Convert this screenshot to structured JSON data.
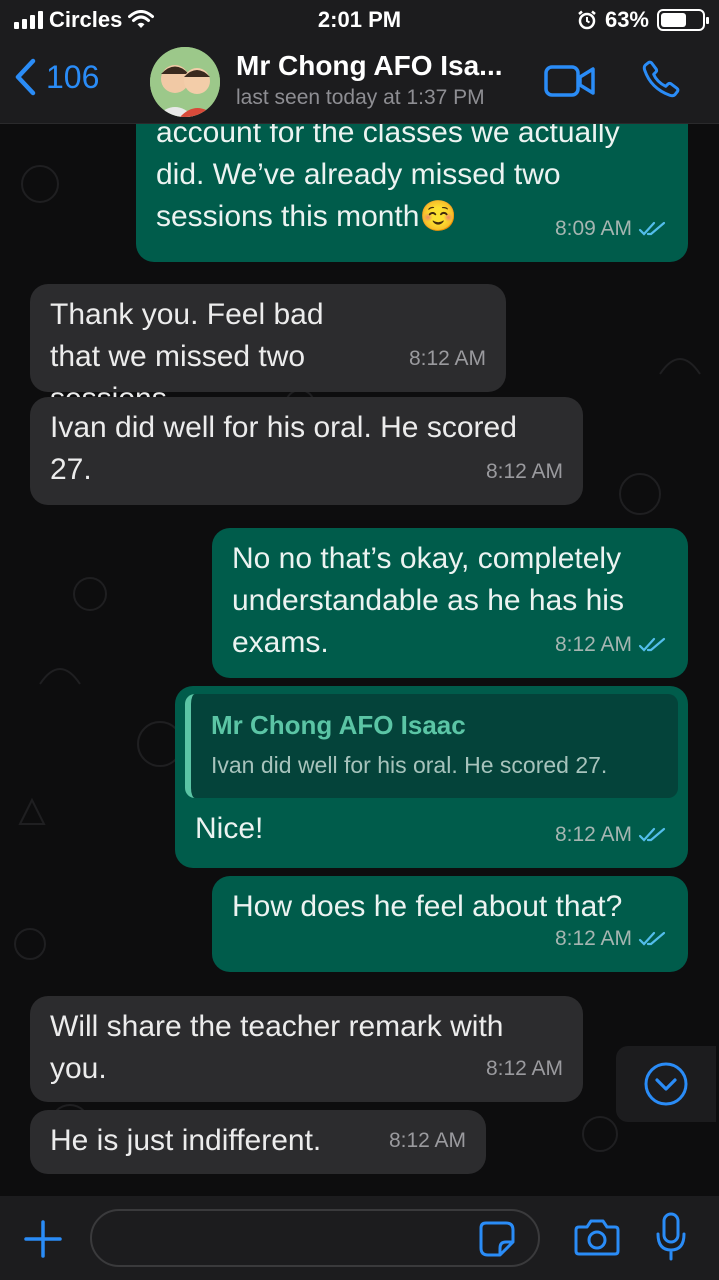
{
  "status_bar": {
    "carrier": "Circles",
    "time": "2:01 PM",
    "battery": "63%",
    "battery_level": 0.63
  },
  "header": {
    "back_count": "106",
    "contact_name": "Mr Chong AFO Isa...",
    "last_seen": "last seen today at 1:37 PM"
  },
  "messages": [
    {
      "direction": "outgoing",
      "text": "account for the classes we actually did. We’ve already missed two sessions this month☺️",
      "time": "8:09 AM",
      "read": true
    },
    {
      "direction": "incoming",
      "text": "Thank you. Feel bad that we missed two sessions.",
      "time": "8:12 AM"
    },
    {
      "direction": "incoming",
      "text": "Ivan did well for his oral. He scored 27.",
      "time": "8:12 AM"
    },
    {
      "direction": "outgoing",
      "text": "No no that’s okay, completely understandable as he has his exams.",
      "time": "8:12 AM",
      "read": true
    },
    {
      "direction": "outgoing",
      "quote_author": "Mr Chong AFO Isaac",
      "quote_text": "Ivan did well for his oral. He scored 27.",
      "text": "Nice!",
      "time": "8:12 AM",
      "read": true
    },
    {
      "direction": "outgoing",
      "text": "How does he feel about that?",
      "time": "8:12 AM",
      "read": true
    },
    {
      "direction": "incoming",
      "text": "Will share the teacher remark with you.",
      "time": "8:12 AM"
    },
    {
      "direction": "incoming",
      "text": "He is just indifferent.",
      "time": "8:12 AM"
    }
  ],
  "input": {
    "value": "",
    "placeholder": ""
  },
  "colors": {
    "accent": "#2a8cf7",
    "outgoing_bubble": "#005c4b",
    "incoming_bubble": "#2c2c2e",
    "read_ticks": "#53bdeb"
  },
  "icons": [
    "back-chevron-icon",
    "video-call-icon",
    "phone-icon",
    "scroll-down-icon",
    "add-icon",
    "sticker-icon",
    "camera-icon",
    "microphone-icon"
  ]
}
